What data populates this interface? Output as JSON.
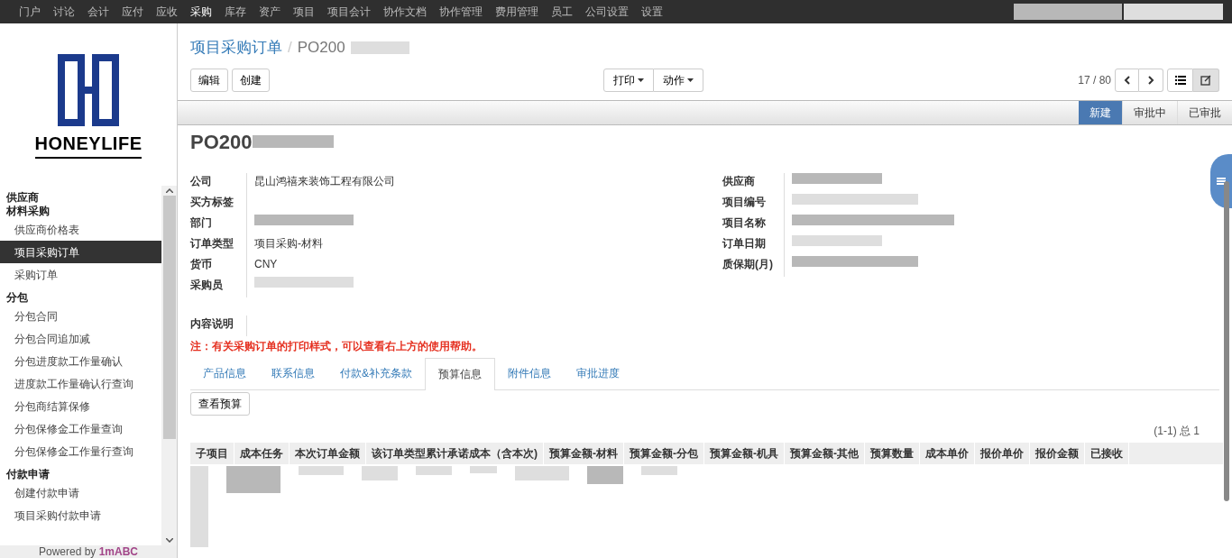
{
  "top_nav": [
    {
      "label": "门户",
      "selected": false
    },
    {
      "label": "讨论",
      "selected": false
    },
    {
      "label": "会计",
      "selected": false
    },
    {
      "label": "应付",
      "selected": false
    },
    {
      "label": "应收",
      "selected": false
    },
    {
      "label": "采购",
      "selected": true
    },
    {
      "label": "库存",
      "selected": false
    },
    {
      "label": "资产",
      "selected": false
    },
    {
      "label": "项目",
      "selected": false
    },
    {
      "label": "项目会计",
      "selected": false
    },
    {
      "label": "协作文档",
      "selected": false
    },
    {
      "label": "协作管理",
      "selected": false
    },
    {
      "label": "费用管理",
      "selected": false
    },
    {
      "label": "员工",
      "selected": false
    },
    {
      "label": "公司设置",
      "selected": false
    },
    {
      "label": "设置",
      "selected": false
    }
  ],
  "logo": {
    "text": "HONEYLIFE"
  },
  "sidebar": {
    "items": [
      {
        "kind": "header",
        "label": "供应商",
        "selected": false
      },
      {
        "kind": "header",
        "label": "材料采购",
        "selected": false
      },
      {
        "kind": "item",
        "label": "供应商价格表",
        "selected": false
      },
      {
        "kind": "item",
        "label": "项目采购订单",
        "selected": true
      },
      {
        "kind": "item",
        "label": "采购订单",
        "selected": false
      },
      {
        "kind": "header",
        "label": "分包",
        "selected": false
      },
      {
        "kind": "item",
        "label": "分包合同",
        "selected": false
      },
      {
        "kind": "item",
        "label": "分包合同追加减",
        "selected": false
      },
      {
        "kind": "item",
        "label": "分包进度款工作量确认",
        "selected": false
      },
      {
        "kind": "item",
        "label": "进度款工作量确认行查询",
        "selected": false
      },
      {
        "kind": "item",
        "label": "分包商结算保修",
        "selected": false
      },
      {
        "kind": "item",
        "label": "分包保修金工作量查询",
        "selected": false
      },
      {
        "kind": "item",
        "label": "分包保修金工作量行查询",
        "selected": false
      },
      {
        "kind": "header",
        "label": "付款申请",
        "selected": false
      },
      {
        "kind": "item",
        "label": "创建付款申请",
        "selected": false
      },
      {
        "kind": "item",
        "label": "项目采购付款申请",
        "selected": false
      }
    ],
    "footer_text": "Powered by ",
    "footer_brand": "1mABC"
  },
  "breadcrumb": {
    "parent": "项目采购订单",
    "separator": "/",
    "current": "PO200"
  },
  "buttons": {
    "left": [
      "编辑",
      "创建"
    ],
    "center": [
      "打印",
      "动作"
    ]
  },
  "pager": {
    "text": "17 / 80"
  },
  "view_switch": [
    {
      "kind": "list",
      "selected": false
    },
    {
      "kind": "form",
      "selected": true
    }
  ],
  "status_steps": [
    {
      "label": "新建",
      "selected": true
    },
    {
      "label": "审批中",
      "selected": false
    },
    {
      "label": "已审批",
      "selected": false
    }
  ],
  "record_title": "PO200",
  "fields_left": [
    {
      "label": "公司",
      "kind": "text",
      "value": "昆山鸿禧来装饰工程有限公司"
    },
    {
      "label": "买方标签",
      "kind": "empty"
    },
    {
      "label": "部门",
      "kind": "blurred"
    },
    {
      "label": "订单类型",
      "kind": "text",
      "value": "项目采购-材料"
    },
    {
      "label": "货币",
      "kind": "text",
      "value": "CNY"
    },
    {
      "label": "采购员",
      "kind": "blurred"
    }
  ],
  "fields_right": [
    {
      "label": "供应商",
      "kind": "blurred"
    },
    {
      "label": "项目编号",
      "kind": "blurred"
    },
    {
      "label": "项目名称",
      "kind": "blurred"
    },
    {
      "label": "订单日期",
      "kind": "blurred"
    },
    {
      "label": "质保期(月)",
      "kind": "blurred"
    }
  ],
  "description_label": "内容说明",
  "note": "注：有关采购订单的打印样式，可以查看右上方的使用帮助。",
  "tabs": [
    {
      "label": "产品信息",
      "selected": false
    },
    {
      "label": "联系信息",
      "selected": false
    },
    {
      "label": "付款&补充条款",
      "selected": false
    },
    {
      "label": "预算信息",
      "selected": true
    },
    {
      "label": "附件信息",
      "selected": false
    },
    {
      "label": "审批进度",
      "selected": false
    }
  ],
  "view_budget_button": "查看预算",
  "table": {
    "count": "(1-1) 总 1",
    "columns": [
      "子项目",
      "成本任务",
      "本次订单金额",
      "该订单类型累计承诺成本（含本次)",
      "预算金额-材料",
      "预算金额-分包",
      "预算金额-机具",
      "预算金额-其他",
      "预算数量",
      "成本单价",
      "报价单价",
      "报价金额",
      "已接收"
    ]
  }
}
